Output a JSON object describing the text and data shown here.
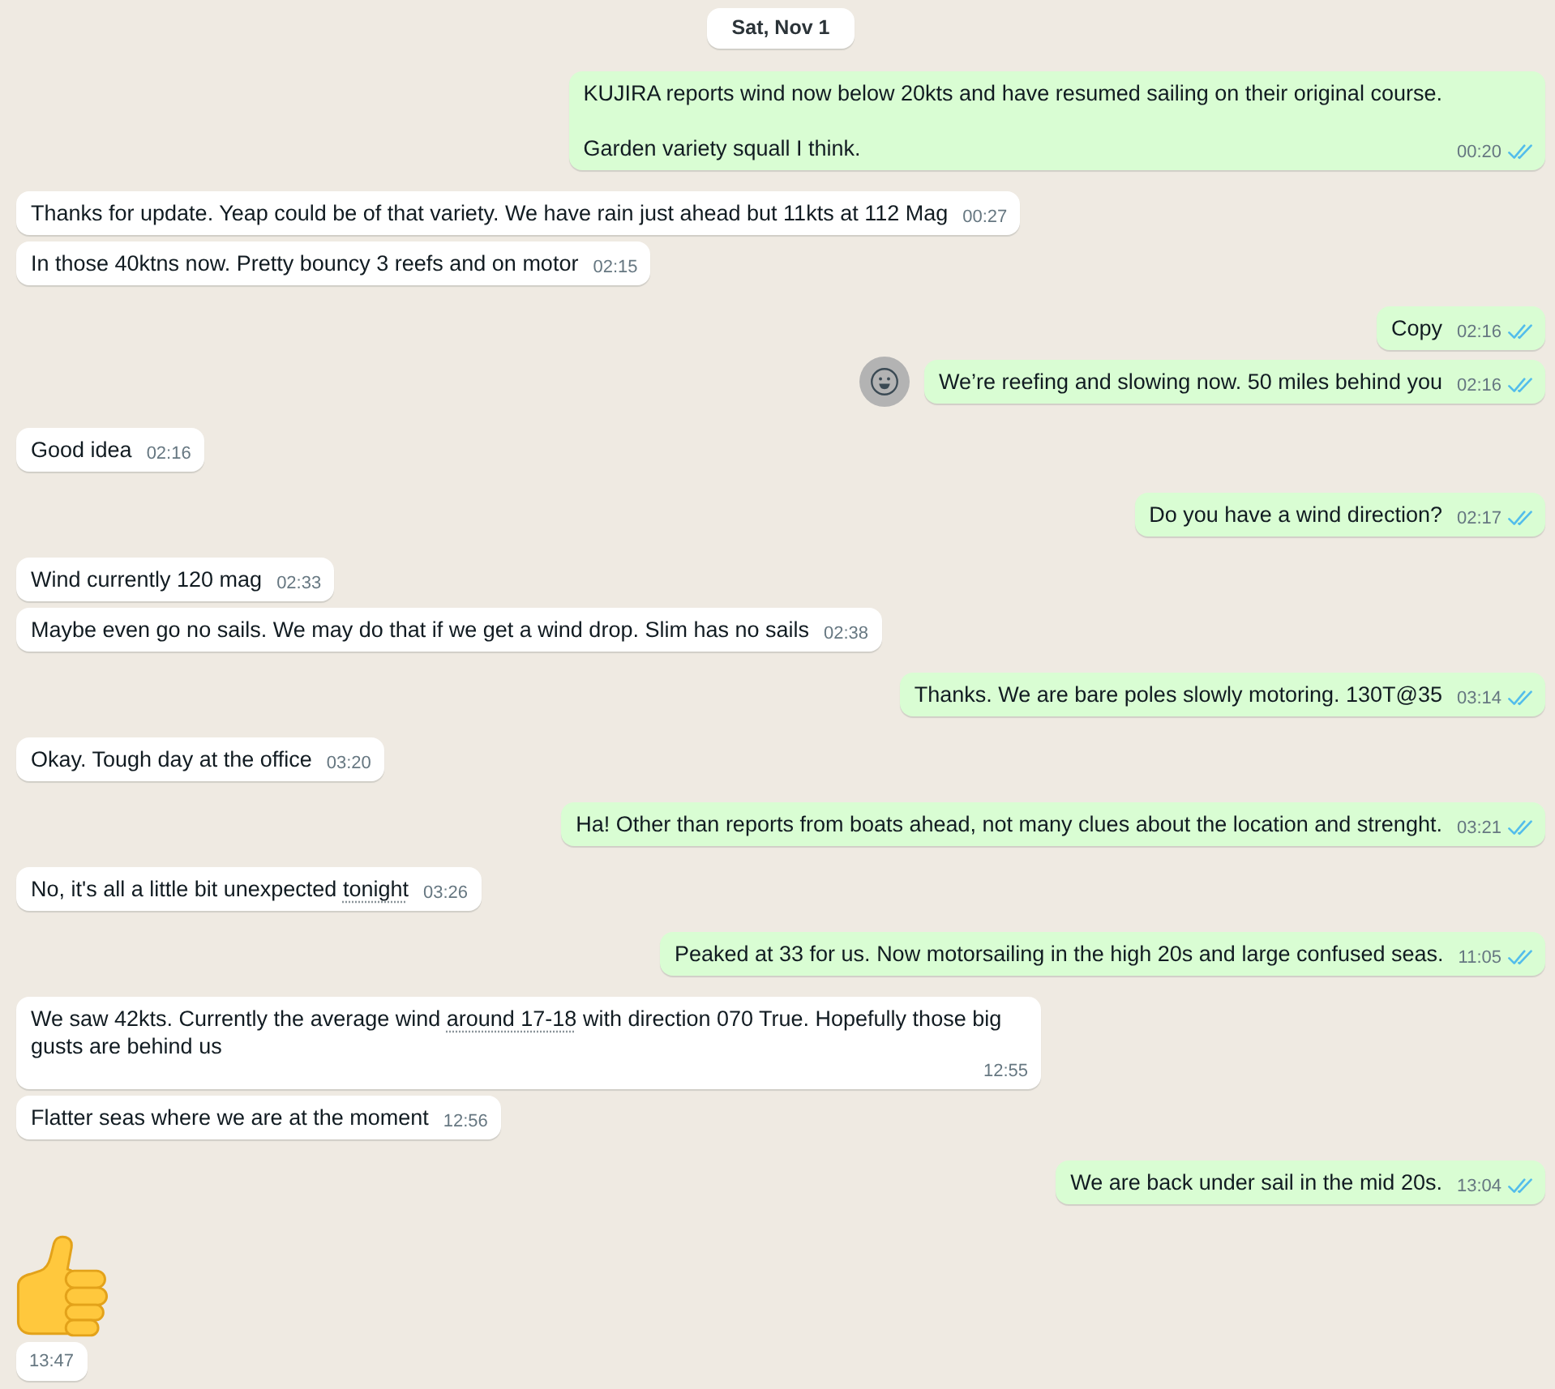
{
  "date_divider": "Sat, Nov 1",
  "messages": [
    {
      "kind": "outgoing",
      "text": "KUJIRA reports wind now below 20kts and have resumed sailing on their original course.\n\nGarden variety squall I think.",
      "time": "00:20",
      "read": true,
      "hovered": false
    },
    {
      "kind": "incoming",
      "text": "Thanks for update. Yeap could be of that variety. We have rain just ahead but 11kts at 112 Mag",
      "time": "00:27"
    },
    {
      "kind": "incoming",
      "text": "In those 40ktns now. Pretty bouncy 3 reefs and on motor",
      "time": "02:15"
    },
    {
      "kind": "outgoing",
      "text": "Copy",
      "time": "02:16",
      "read": true,
      "hovered": false
    },
    {
      "kind": "outgoing",
      "text": "We’re reefing and slowing now. 50 miles behind you",
      "time": "02:16",
      "read": true,
      "hovered": true
    },
    {
      "kind": "incoming",
      "text": "Good idea",
      "time": "02:16"
    },
    {
      "kind": "outgoing",
      "text": "Do you have a wind direction?",
      "time": "02:17",
      "read": true,
      "hovered": false
    },
    {
      "kind": "incoming",
      "text": "Wind currently 120 mag",
      "time": "02:33"
    },
    {
      "kind": "incoming",
      "text": "Maybe even go no sails. We may do that if we get a wind drop. Slim has no sails",
      "time": "02:38"
    },
    {
      "kind": "outgoing",
      "text": "Thanks. We are bare poles slowly motoring. 130T@35",
      "time": "03:14",
      "read": true,
      "hovered": false
    },
    {
      "kind": "incoming",
      "text": "Okay. Tough day at the office",
      "time": "03:20"
    },
    {
      "kind": "outgoing",
      "text": "Ha! Other than reports from boats ahead, not many clues about the location and strenght.",
      "time": "03:21",
      "read": true,
      "hovered": false
    },
    {
      "kind": "incoming",
      "parts": [
        {
          "kind": "plain",
          "text": "No, it's all a little bit unexpected "
        },
        {
          "kind": "link",
          "text": "tonight"
        }
      ],
      "time": "03:26"
    },
    {
      "kind": "outgoing",
      "text": "Peaked at 33 for us. Now motorsailing in the high 20s and large confused seas.",
      "time": "11:05",
      "read": true,
      "hovered": false
    },
    {
      "kind": "incoming",
      "parts": [
        {
          "kind": "plain",
          "text": "We saw 42kts. Currently the average wind "
        },
        {
          "kind": "link",
          "text": "around 17-18"
        },
        {
          "kind": "plain",
          "text": " with direction 070 True. Hopefully those big gusts are behind us"
        }
      ],
      "time": "12:55"
    },
    {
      "kind": "incoming",
      "text": "Flatter seas where we are at the moment",
      "time": "12:56"
    },
    {
      "kind": "outgoing",
      "text": "We are back under sail in the mid 20s.",
      "time": "13:04",
      "read": true,
      "hovered": false
    },
    {
      "kind": "emoji",
      "time": "13:47"
    }
  ]
}
